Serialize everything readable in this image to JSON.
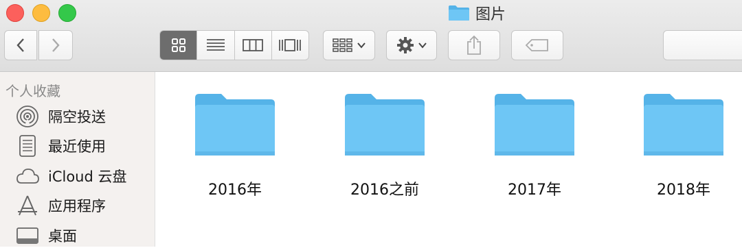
{
  "window": {
    "title": "图片"
  },
  "toolbar": {
    "back_icon": "chevron-left-icon",
    "forward_icon": "chevron-right-icon",
    "view_modes": [
      "icon-view",
      "list-view",
      "column-view",
      "cover-flow-view"
    ],
    "active_view": "icon-view",
    "arrange_icon": "group-by-icon",
    "action_icon": "gear-icon",
    "share_icon": "share-icon",
    "tags_icon": "tag-icon"
  },
  "sidebar": {
    "heading": "个人收藏",
    "items": [
      {
        "label": "隔空投送",
        "icon": "airdrop-icon"
      },
      {
        "label": "最近使用",
        "icon": "recents-icon"
      },
      {
        "label": "iCloud 云盘",
        "icon": "cloud-icon"
      },
      {
        "label": "应用程序",
        "icon": "applications-icon"
      },
      {
        "label": "桌面",
        "icon": "desktop-icon"
      }
    ]
  },
  "files": [
    {
      "name": "2016年",
      "type": "folder"
    },
    {
      "name": "2016之前",
      "type": "folder"
    },
    {
      "name": "2017年",
      "type": "folder"
    },
    {
      "name": "2018年",
      "type": "folder"
    }
  ],
  "colors": {
    "folder": "#6ec6f5",
    "folder_dark": "#55b3e8",
    "active_segment": "#6d6d6d"
  }
}
